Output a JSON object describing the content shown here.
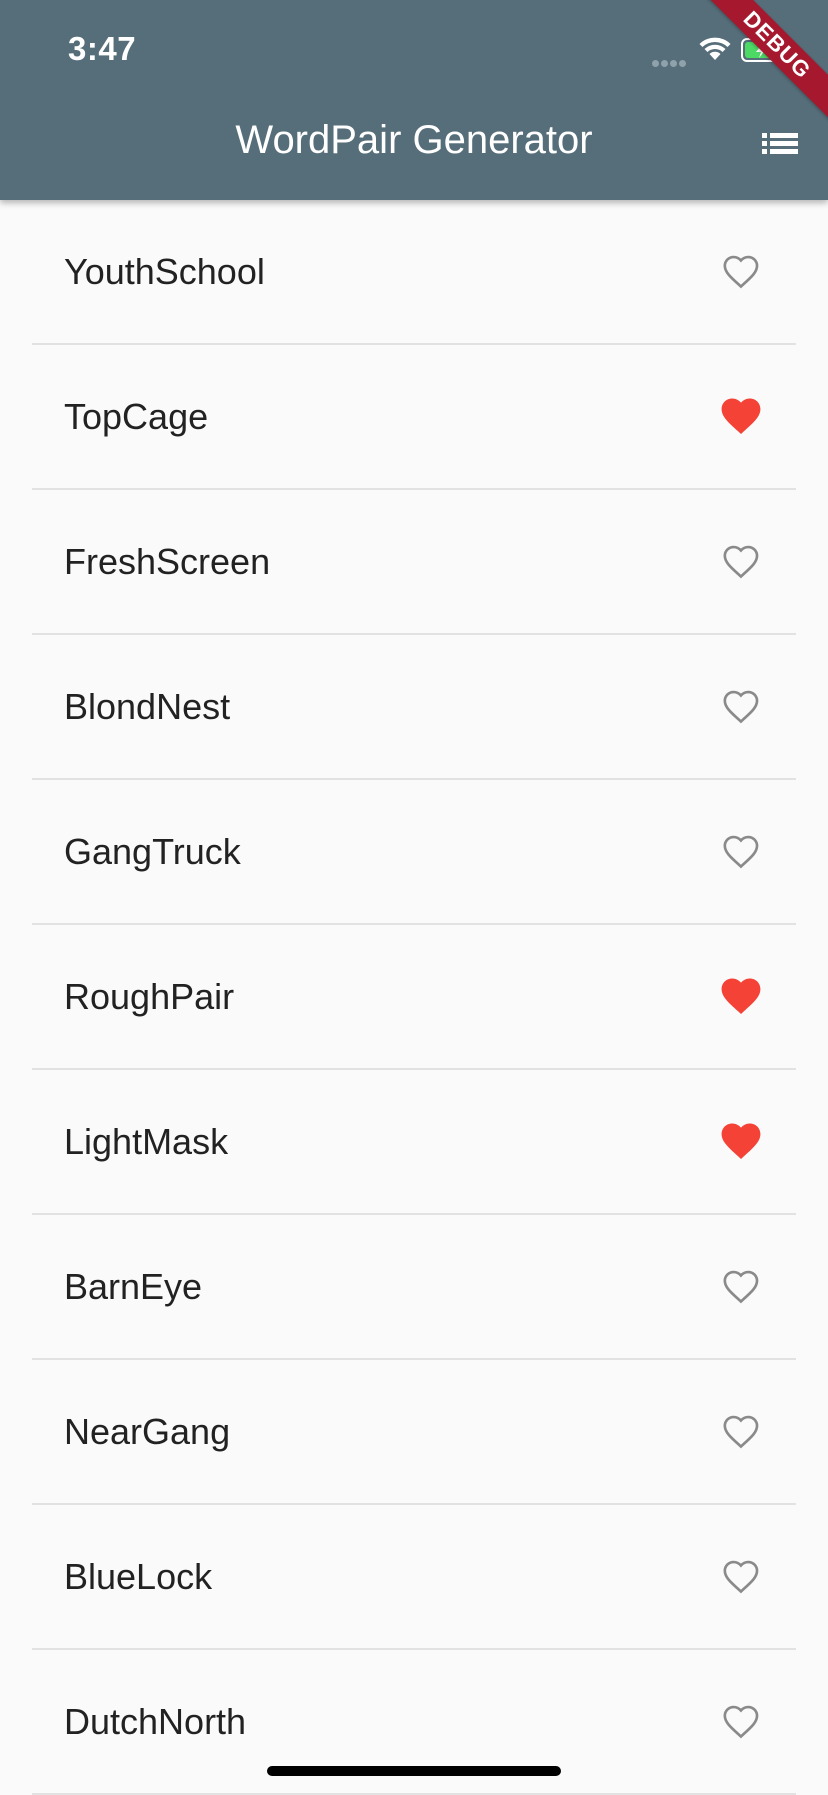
{
  "status_bar": {
    "time": "3:47"
  },
  "debug_banner": "DEBUG",
  "app_bar": {
    "title": "WordPair Generator",
    "action_icon": "list-icon",
    "background": "#566e7a"
  },
  "colors": {
    "favorite_filled": "#f44336",
    "favorite_outline": "#8a8a8a"
  },
  "word_pairs": [
    {
      "label": "YouthSchool",
      "favorited": false
    },
    {
      "label": "TopCage",
      "favorited": true
    },
    {
      "label": "FreshScreen",
      "favorited": false
    },
    {
      "label": "BlondNest",
      "favorited": false
    },
    {
      "label": "GangTruck",
      "favorited": false
    },
    {
      "label": "RoughPair",
      "favorited": true
    },
    {
      "label": "LightMask",
      "favorited": true
    },
    {
      "label": "BarnEye",
      "favorited": false
    },
    {
      "label": "NearGang",
      "favorited": false
    },
    {
      "label": "BlueLock",
      "favorited": false
    },
    {
      "label": "DutchNorth",
      "favorited": false
    }
  ]
}
